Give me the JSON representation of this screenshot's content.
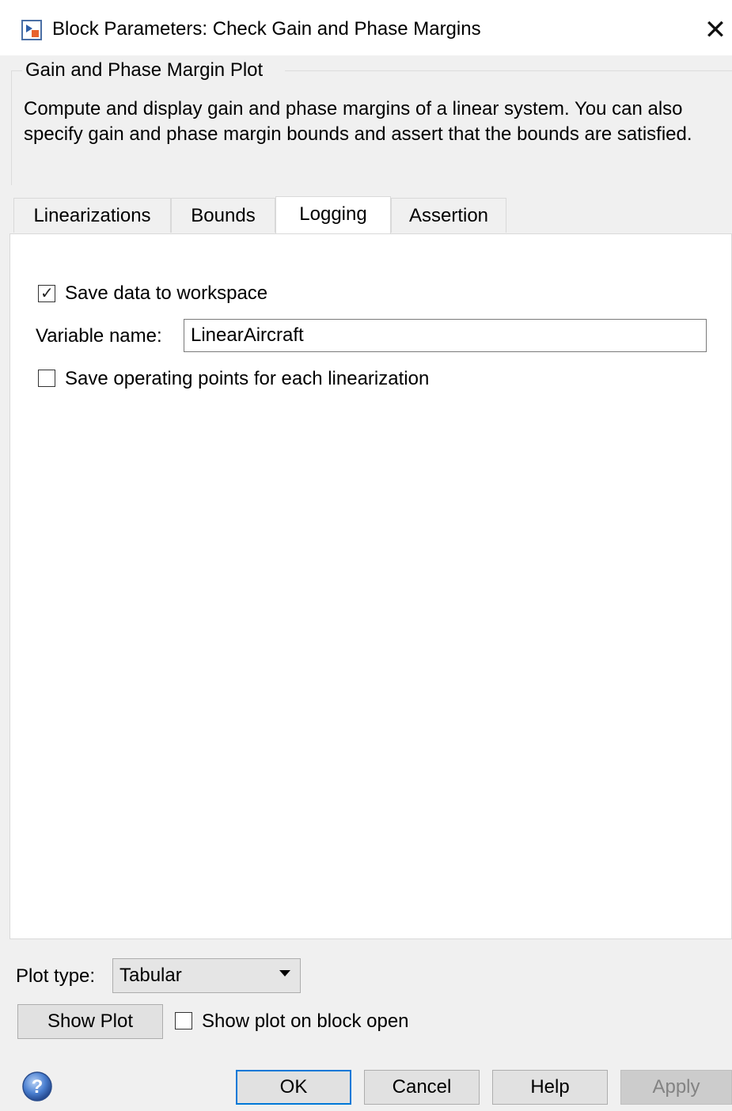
{
  "window": {
    "title": "Block Parameters: Check Gain and Phase Margins",
    "close_symbol": "✕",
    "app_icon": "simulink-block-icon"
  },
  "header": {
    "group_title": "Gain and Phase Margin Plot",
    "description": "Compute and display gain and phase margins of a linear system. You can also specify gain and phase margin bounds and assert that the bounds are satisfied."
  },
  "tabs": [
    {
      "label": "Linearizations",
      "active": false
    },
    {
      "label": "Bounds",
      "active": false
    },
    {
      "label": "Logging",
      "active": true
    },
    {
      "label": "Assertion",
      "active": false
    }
  ],
  "logging": {
    "save_data_label": "Save data to workspace",
    "save_data_checked": true,
    "variable_name_label": "Variable name:",
    "variable_name_value": "LinearAircraft",
    "save_op_points_label": "Save operating points for each linearization",
    "save_op_points_checked": false
  },
  "plot": {
    "type_label": "Plot type:",
    "type_value": "Tabular",
    "show_plot_label": "Show Plot",
    "show_on_open_label": "Show plot on block open",
    "show_on_open_checked": false
  },
  "footer": {
    "help_icon": "question-mark-icon",
    "ok_label": "OK",
    "cancel_label": "Cancel",
    "help_label": "Help",
    "apply_label": "Apply"
  },
  "colors": {
    "accent": "#0078d7",
    "background": "#f0f0f0",
    "panel": "#ffffff"
  }
}
